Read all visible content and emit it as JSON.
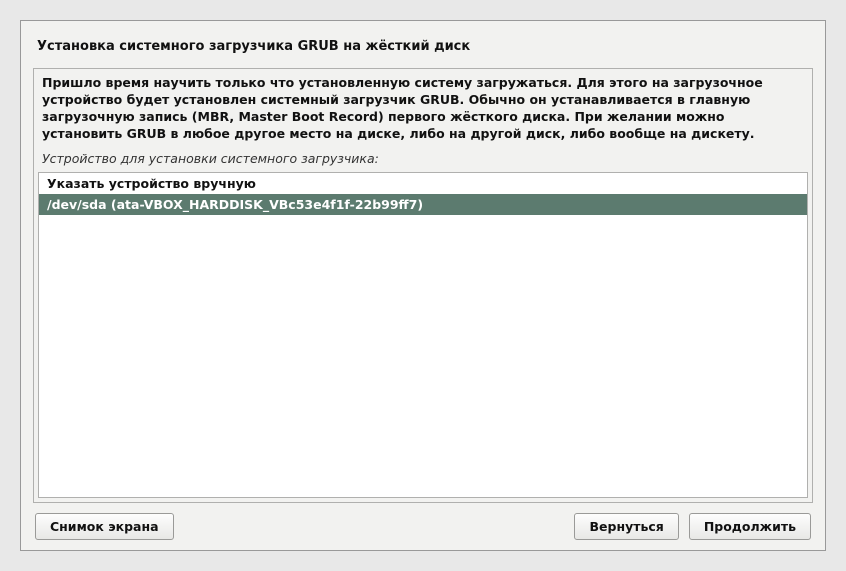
{
  "title": "Установка системного загрузчика GRUB на жёсткий диск",
  "instructions": "Пришло время научить только что установленную систему загружаться. Для этого на загрузочное устройство будет установлен системный загрузчик GRUB. Обычно он устанавливается в главную загрузочную запись (MBR, Master Boot Record) первого жёсткого диска. При желании можно установить GRUB в любое другое место на диске, либо на другой диск, либо вообще на дискету.",
  "prompt": "Устройство для установки системного загрузчика:",
  "options": [
    {
      "label": "Указать устройство вручную",
      "selected": false
    },
    {
      "label": "/dev/sda  (ata-VBOX_HARDDISK_VBc53e4f1f-22b99ff7)",
      "selected": true
    }
  ],
  "buttons": {
    "screenshot": "Снимок экрана",
    "back": "Вернуться",
    "continue": "Продолжить"
  }
}
